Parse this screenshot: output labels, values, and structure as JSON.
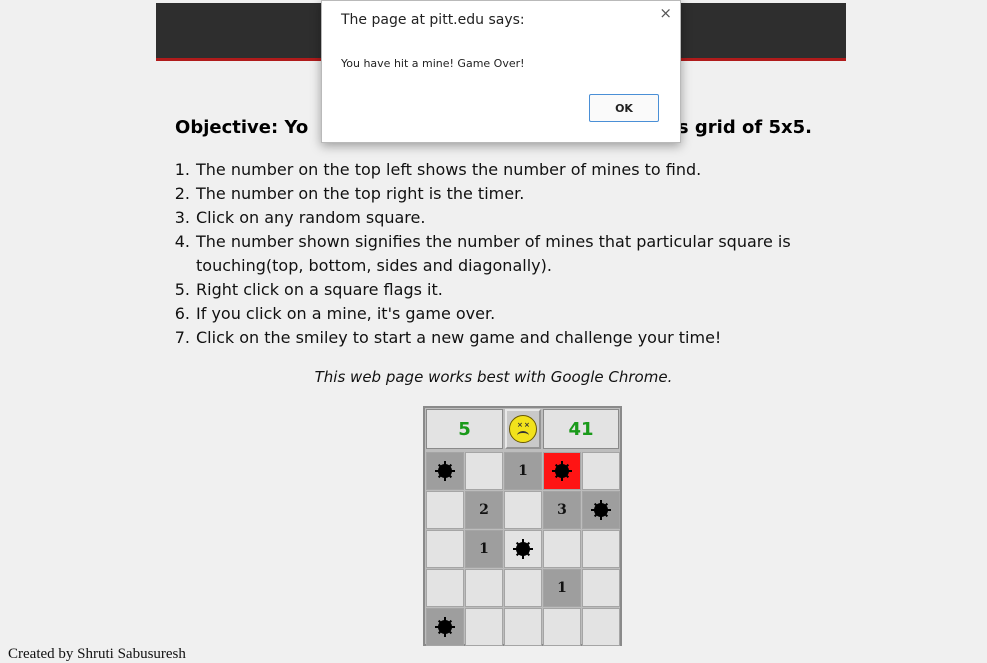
{
  "page": {
    "objective": "Objective: Yo                                                           s grid of 5x5.",
    "rules": [
      {
        "num": "1.",
        "text": "The number on the top left shows the number of mines to find."
      },
      {
        "num": "2.",
        "text": "The number on the top right is the timer."
      },
      {
        "num": "3.",
        "text": "Click on any random square."
      },
      {
        "num": "4.",
        "text": "The number shown signifies the number of mines that particular square is touching(top, bottom, sides and diagonally)."
      },
      {
        "num": "5.",
        "text": "Right click on a square flags it."
      },
      {
        "num": "6.",
        "text": "If you click on a mine, it's game over."
      },
      {
        "num": "7.",
        "text": "Click on the smiley to start a new game and challenge your time!"
      }
    ],
    "note": "This web page works best with Google Chrome.",
    "footer": "Created by Shruti Sabusuresh"
  },
  "game": {
    "mines_left": "5",
    "timer": "41",
    "face": "dead-smiley-icon",
    "colors": {
      "counter_text": "#1a9a1a",
      "exploded": "#ff1414"
    },
    "grid": [
      [
        {
          "s": "mine"
        },
        {
          "s": "hidden"
        },
        {
          "s": "revealed",
          "v": "1"
        },
        {
          "s": "exploded"
        },
        {
          "s": "hidden"
        }
      ],
      [
        {
          "s": "hidden"
        },
        {
          "s": "revealed",
          "v": "2"
        },
        {
          "s": "hidden"
        },
        {
          "s": "revealed",
          "v": "3"
        },
        {
          "s": "mine"
        }
      ],
      [
        {
          "s": "hidden"
        },
        {
          "s": "revealed",
          "v": "1"
        },
        {
          "s": "mine-plain"
        },
        {
          "s": "hidden"
        },
        {
          "s": "hidden"
        }
      ],
      [
        {
          "s": "hidden"
        },
        {
          "s": "hidden"
        },
        {
          "s": "hidden"
        },
        {
          "s": "revealed",
          "v": "1"
        },
        {
          "s": "hidden"
        }
      ],
      [
        {
          "s": "mine"
        },
        {
          "s": "hidden"
        },
        {
          "s": "hidden"
        },
        {
          "s": "hidden"
        },
        {
          "s": "hidden"
        }
      ]
    ]
  },
  "dialog": {
    "title": "The page at pitt.edu says:",
    "message": "You have hit a mine! Game Over!",
    "ok_label": "OK",
    "close_glyph": "×"
  }
}
